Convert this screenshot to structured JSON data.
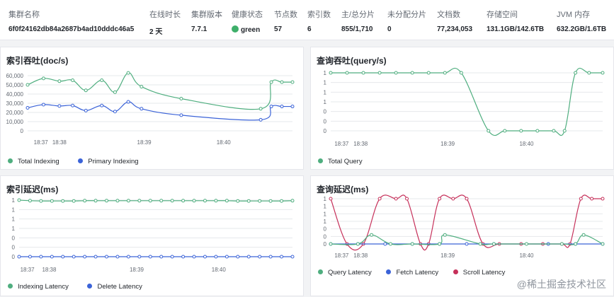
{
  "summary": {
    "columns": [
      {
        "label": "集群名称",
        "value": "6f0f24162db84a2687b4ad10dddc46a5"
      },
      {
        "label": "在线时长",
        "value": "2 天"
      },
      {
        "label": "集群版本",
        "value": "7.7.1"
      },
      {
        "label": "健康状态",
        "value": "green"
      },
      {
        "label": "节点数",
        "value": "57"
      },
      {
        "label": "索引数",
        "value": "6"
      },
      {
        "label": "主/总分片",
        "value": "855/1,710"
      },
      {
        "label": "未分配分片",
        "value": "0"
      },
      {
        "label": "文档数",
        "value": "77,234,053"
      },
      {
        "label": "存储空间",
        "value": "131.1GB/142.6TB"
      },
      {
        "label": "JVM 内存",
        "value": "632.2GB/1.6TB"
      }
    ],
    "health_color": "#3eaf6a"
  },
  "colors": {
    "green": "#4fae7f",
    "blue": "#3b63d8",
    "red": "#c6305a"
  },
  "watermark": "@稀土掘金技术社区",
  "panels": {
    "indexing_throughput": {
      "title": "索引吞吐(doc/s)",
      "legend": [
        "Total Indexing",
        "Primary Indexing"
      ]
    },
    "query_throughput": {
      "title": "查询吞吐(query/s)",
      "legend": [
        "Total Query"
      ]
    },
    "indexing_latency": {
      "title": "索引延迟(ms)",
      "legend": [
        "Indexing Latency",
        "Delete Latency"
      ]
    },
    "query_latency": {
      "title": "查询延迟(ms)",
      "legend": [
        "Query Latency",
        "Fetch Latency",
        "Scroll Latency"
      ]
    }
  },
  "chart_data": [
    {
      "type": "line",
      "title": "索引吞吐(doc/s)",
      "x_ticks": [
        "18:37",
        "18:38",
        "18:39",
        "18:40"
      ],
      "y_ticks": [
        "60,000",
        "50,000",
        "40,000",
        "30,000",
        "20,000",
        "10,000",
        "0"
      ],
      "ylim": [
        0,
        60000
      ],
      "series": [
        {
          "name": "Total Indexing",
          "color": "#4fae7f",
          "values": [
            50000,
            57000,
            54000,
            55000,
            44000,
            55000,
            42000,
            63000,
            48000,
            35000,
            24000,
            53000,
            53000,
            53000
          ],
          "markers": [
            true,
            true,
            true,
            true,
            true,
            true,
            true,
            true,
            true,
            true,
            true,
            true,
            true,
            true
          ]
        },
        {
          "name": "Primary Indexing",
          "color": "#3b63d8",
          "values": [
            25000,
            28500,
            27000,
            27500,
            22000,
            27500,
            21000,
            31500,
            24000,
            17000,
            12000,
            26500,
            26500,
            26500
          ],
          "markers": [
            true,
            true,
            true,
            true,
            true,
            true,
            true,
            true,
            true,
            true,
            true,
            true,
            true,
            true
          ]
        }
      ],
      "x_index": [
        0,
        1,
        2,
        3,
        4,
        5,
        6,
        7,
        8,
        9,
        10,
        11,
        12,
        13
      ],
      "x_pos": [
        0.0,
        0.06,
        0.12,
        0.17,
        0.22,
        0.28,
        0.33,
        0.38,
        0.43,
        0.58,
        0.88,
        0.92,
        0.96,
        1.0
      ]
    },
    {
      "type": "line",
      "title": "查询吞吐(query/s)",
      "x_ticks": [
        "18:37",
        "18:38",
        "18:39",
        "18:40"
      ],
      "y_ticks": [
        "1",
        "1",
        "1",
        "1",
        "0",
        "0",
        "0"
      ],
      "ylim": [
        0,
        1
      ],
      "series": [
        {
          "name": "Total Query",
          "color": "#4fae7f",
          "values": [
            1,
            1,
            1,
            1,
            1,
            1,
            1,
            1,
            1,
            0,
            0,
            0,
            0,
            0,
            0,
            1,
            1,
            1
          ],
          "x_pos": [
            0.0,
            0.06,
            0.12,
            0.18,
            0.24,
            0.3,
            0.36,
            0.42,
            0.48,
            0.58,
            0.64,
            0.7,
            0.76,
            0.82,
            0.86,
            0.9,
            0.95,
            1.0
          ]
        }
      ]
    },
    {
      "type": "line",
      "title": "索引延迟(ms)",
      "x_ticks": [
        "18:37",
        "18:38",
        "18:39",
        "18:40"
      ],
      "y_ticks": [
        "1",
        "1",
        "1",
        "1",
        "0",
        "0",
        "0"
      ],
      "ylim": [
        0,
        1
      ],
      "series": [
        {
          "name": "Indexing Latency",
          "color": "#4fae7f",
          "values": [
            1,
            0.99,
            0.985,
            0.985,
            0.985,
            0.985,
            0.99,
            0.99,
            0.99,
            0.99,
            0.99,
            0.99,
            0.99,
            0.99,
            0.99,
            0.99,
            0.99,
            0.99,
            0.99,
            0.99,
            0.985,
            0.985,
            0.985,
            0.985,
            0.985,
            0.99
          ]
        },
        {
          "name": "Delete Latency",
          "color": "#3b63d8",
          "values": [
            0,
            0,
            0,
            0,
            0,
            0,
            0,
            0,
            0,
            0,
            0,
            0,
            0,
            0,
            0,
            0,
            0,
            0,
            0,
            0,
            0,
            0,
            0,
            0,
            0,
            0
          ]
        }
      ]
    },
    {
      "type": "line",
      "title": "查询延迟(ms)",
      "x_ticks": [
        "18:37",
        "18:38",
        "18:39",
        "18:40"
      ],
      "y_ticks": [
        "1",
        "1",
        "1",
        "1",
        "0",
        "0",
        "0"
      ],
      "ylim": [
        0,
        1
      ],
      "series": [
        {
          "name": "Query Latency",
          "color": "#4fae7f",
          "values": [
            0,
            0,
            0.2,
            0,
            0,
            0,
            0.2,
            0,
            0,
            0,
            0,
            0,
            0.2,
            0
          ],
          "x_pos": [
            0.0,
            0.1,
            0.15,
            0.22,
            0.3,
            0.4,
            0.42,
            0.55,
            0.6,
            0.72,
            0.85,
            0.9,
            0.93,
            1.0
          ]
        },
        {
          "name": "Fetch Latency",
          "color": "#3b63d8",
          "values": [
            0,
            0,
            0,
            0,
            0,
            0,
            0,
            0,
            0,
            0
          ],
          "x_pos": [
            0.0,
            0.1,
            0.2,
            0.3,
            0.4,
            0.5,
            0.6,
            0.8,
            0.9,
            1.0
          ]
        },
        {
          "name": "Scroll Latency",
          "color": "#c6305a",
          "values": [
            1,
            0,
            0,
            1,
            1,
            1,
            0,
            0,
            1,
            1,
            1,
            0,
            0,
            0,
            0,
            0,
            0,
            1,
            1,
            1
          ],
          "x_pos": [
            0.0,
            0.06,
            0.12,
            0.18,
            0.24,
            0.28,
            0.33,
            0.36,
            0.4,
            0.45,
            0.5,
            0.56,
            0.62,
            0.7,
            0.78,
            0.85,
            0.88,
            0.92,
            0.96,
            1.0
          ]
        }
      ]
    }
  ]
}
